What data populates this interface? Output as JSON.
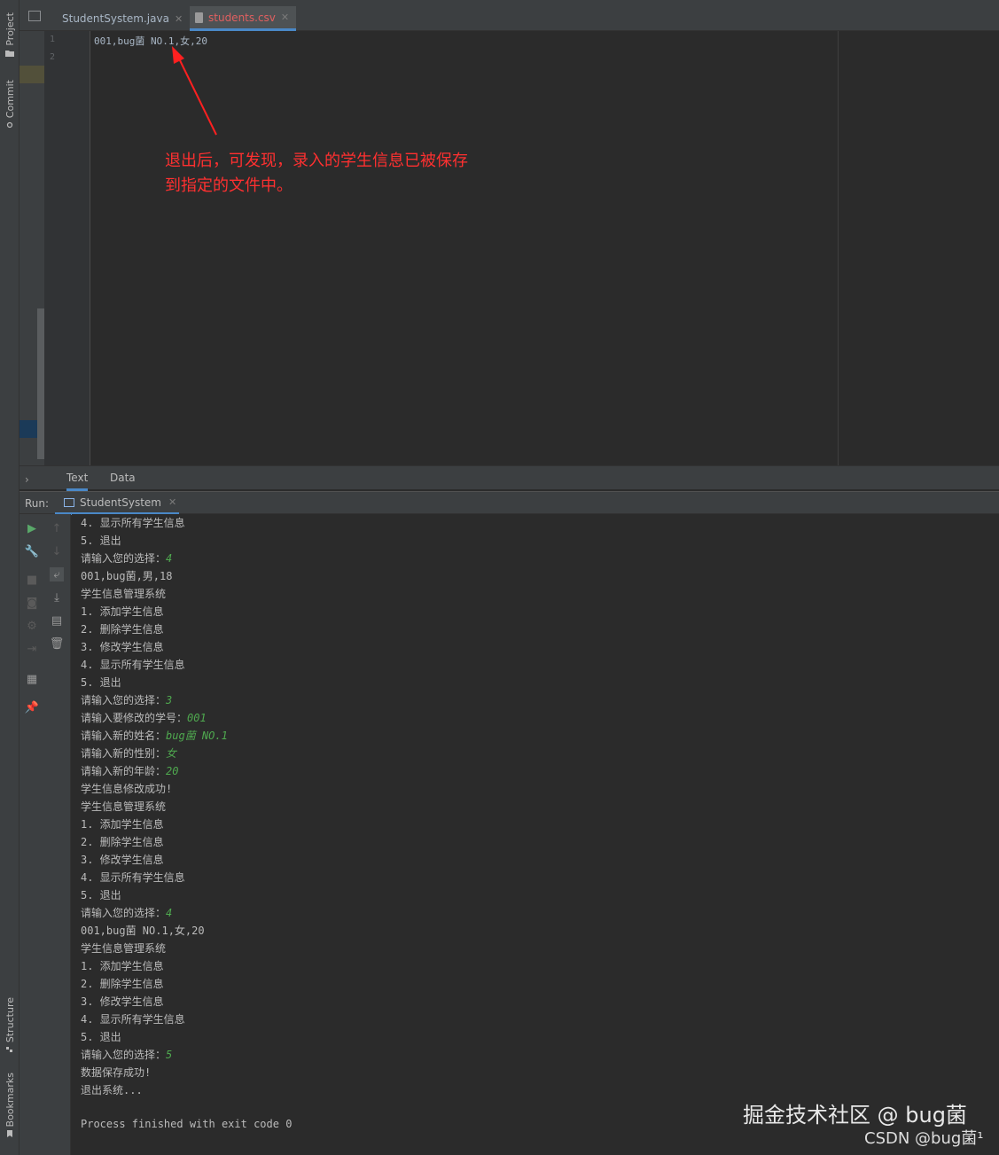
{
  "sidebar": {
    "project_label": "Project",
    "commit_label": "Commit",
    "structure_label": "Structure",
    "bookmarks_label": "Bookmarks"
  },
  "editor_tabs": [
    {
      "label": "StudentSystem.java",
      "active": false,
      "icon": "java-class-icon"
    },
    {
      "label": "students.csv",
      "active": true,
      "icon": "csv-file-icon"
    }
  ],
  "editor": {
    "line_numbers": [
      "1",
      "2"
    ],
    "content": "001,bug菌 NO.1,女,20",
    "bottom_tabs": [
      "Text",
      "Data"
    ]
  },
  "annotation": {
    "line1": "退出后，可发现，录入的学生信息已被保存",
    "line2": "到指定的文件中。",
    "color": "#ff3030"
  },
  "run": {
    "label": "Run:",
    "tab_label": "StudentSystem"
  },
  "console_lines": [
    {
      "text": "4. 显示所有学生信息",
      "input": ""
    },
    {
      "text": "5. 退出",
      "input": ""
    },
    {
      "text": "请输入您的选择：",
      "input": "4"
    },
    {
      "text": "001,bug菌,男,18",
      "input": ""
    },
    {
      "text": "学生信息管理系统",
      "input": ""
    },
    {
      "text": "1. 添加学生信息",
      "input": ""
    },
    {
      "text": "2. 删除学生信息",
      "input": ""
    },
    {
      "text": "3. 修改学生信息",
      "input": ""
    },
    {
      "text": "4. 显示所有学生信息",
      "input": ""
    },
    {
      "text": "5. 退出",
      "input": ""
    },
    {
      "text": "请输入您的选择：",
      "input": "3"
    },
    {
      "text": "请输入要修改的学号：",
      "input": "001"
    },
    {
      "text": "请输入新的姓名：",
      "input": "bug菌 NO.1"
    },
    {
      "text": "请输入新的性别：",
      "input": "女"
    },
    {
      "text": "请输入新的年龄：",
      "input": "20"
    },
    {
      "text": "学生信息修改成功!",
      "input": ""
    },
    {
      "text": "学生信息管理系统",
      "input": ""
    },
    {
      "text": "1. 添加学生信息",
      "input": ""
    },
    {
      "text": "2. 删除学生信息",
      "input": ""
    },
    {
      "text": "3. 修改学生信息",
      "input": ""
    },
    {
      "text": "4. 显示所有学生信息",
      "input": ""
    },
    {
      "text": "5. 退出",
      "input": ""
    },
    {
      "text": "请输入您的选择：",
      "input": "4"
    },
    {
      "text": "001,bug菌 NO.1,女,20",
      "input": ""
    },
    {
      "text": "学生信息管理系统",
      "input": ""
    },
    {
      "text": "1. 添加学生信息",
      "input": ""
    },
    {
      "text": "2. 删除学生信息",
      "input": ""
    },
    {
      "text": "3. 修改学生信息",
      "input": ""
    },
    {
      "text": "4. 显示所有学生信息",
      "input": ""
    },
    {
      "text": "5. 退出",
      "input": ""
    },
    {
      "text": "请输入您的选择：",
      "input": "5"
    },
    {
      "text": "数据保存成功!",
      "input": ""
    },
    {
      "text": "退出系统...",
      "input": ""
    },
    {
      "text": "",
      "input": ""
    },
    {
      "text": "Process finished with exit code 0",
      "input": ""
    }
  ],
  "watermark": {
    "line1": "掘金技术社区 @ bug菌",
    "line2": "CSDN @bug菌¹"
  }
}
